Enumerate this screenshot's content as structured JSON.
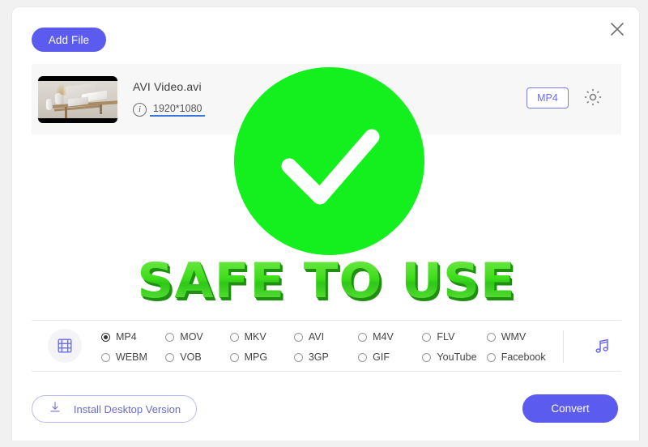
{
  "window": {
    "close_label": "×"
  },
  "toolbar": {
    "add_file_label": "Add File"
  },
  "file": {
    "name": "AVI Video.avi",
    "resolution": "1920*1080",
    "info_glyph": "i",
    "output_format": "MP4"
  },
  "overlay": {
    "badge_text": "SAFE TO USE",
    "circle_color": "#14F01E",
    "check_color": "#FFFFFF",
    "text_color": "#3CE021"
  },
  "formats": {
    "video": [
      {
        "label": "MP4",
        "selected": true
      },
      {
        "label": "MOV",
        "selected": false
      },
      {
        "label": "MKV",
        "selected": false
      },
      {
        "label": "AVI",
        "selected": false
      },
      {
        "label": "M4V",
        "selected": false
      },
      {
        "label": "FLV",
        "selected": false
      },
      {
        "label": "WMV",
        "selected": false
      },
      {
        "label": "WEBM",
        "selected": false
      },
      {
        "label": "VOB",
        "selected": false
      },
      {
        "label": "MPG",
        "selected": false
      },
      {
        "label": "3GP",
        "selected": false
      },
      {
        "label": "GIF",
        "selected": false
      },
      {
        "label": "YouTube",
        "selected": false
      },
      {
        "label": "Facebook",
        "selected": false
      }
    ],
    "grid_order": [
      "MP4",
      "MOV",
      "MKV",
      "AVI",
      "M4V",
      "FLV",
      "WMV",
      "WEBM",
      "VOB",
      "MPG",
      "3GP",
      "GIF",
      "YouTube",
      "Facebook"
    ]
  },
  "footer": {
    "install_label": "Install Desktop Version",
    "convert_label": "Convert"
  },
  "colors": {
    "accent": "#5B5BF0",
    "accent_light": "#7B7BF2",
    "row_bg": "#F7F7F7",
    "page_bg": "#F1F1F1"
  }
}
